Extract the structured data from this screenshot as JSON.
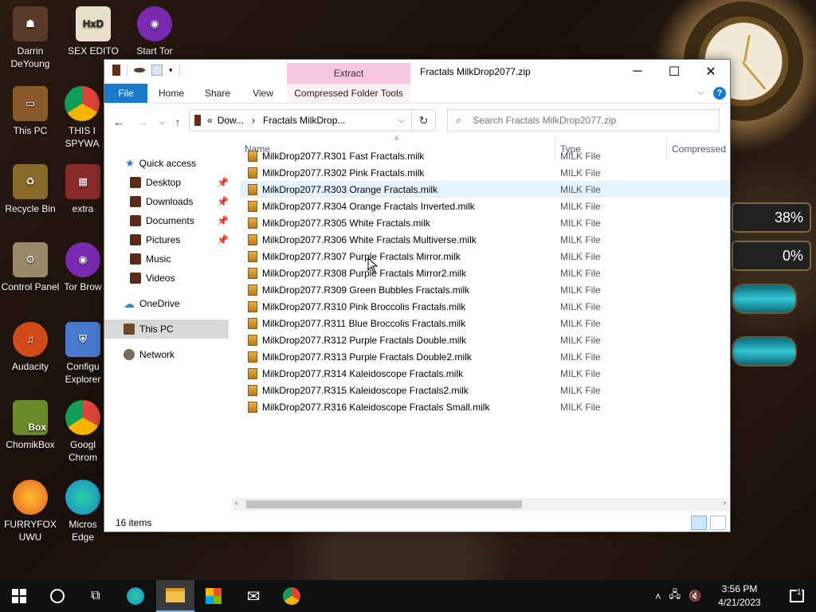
{
  "desktop": {
    "icons": [
      {
        "label": "Darrin DeYoung",
        "color": "#5a3a2a"
      },
      {
        "label": "SEX EDITO",
        "color": "#4a8a3a"
      },
      {
        "label": "Start Tor",
        "color": "#7a2ab0"
      },
      {
        "label": "This PC",
        "color": "#8a5a2a"
      },
      {
        "label": "THIS I SPYWA",
        "color": "#1a73e8"
      },
      {
        "label": "Recycle Bin",
        "color": "#8a6a2a"
      },
      {
        "label": "extra",
        "color": "#8a2a2a"
      },
      {
        "label": "Control Panel",
        "color": "#9a8a6a"
      },
      {
        "label": "Tor Brow",
        "color": "#7a2ab0"
      },
      {
        "label": "Audacity",
        "color": "#d04a1a"
      },
      {
        "label": "Configu Explorer",
        "color": "#4a7ad0"
      },
      {
        "label": "ChomikBox",
        "color": "#6a8a2a"
      },
      {
        "label": "Googl Chrom",
        "color": "#1a73e8"
      },
      {
        "label": "FURRYFOX UWU",
        "color": "#e0602a"
      },
      {
        "label": "Micros Edge",
        "color": "#1a8ad0"
      }
    ],
    "box_label": "Box",
    "gauge1": "38%",
    "gauge2": "0%"
  },
  "window": {
    "title": "Fractals MilkDrop2077.zip",
    "extract_tab": "Extract",
    "ribbon": {
      "file": "File",
      "home": "Home",
      "share": "Share",
      "view": "View",
      "tools": "Compressed Folder Tools"
    },
    "address": {
      "prefix": "«",
      "crumb1": "Dow...",
      "sep": "›",
      "crumb2": "Fractals MilkDrop..."
    },
    "search_placeholder": "Search Fractals MilkDrop2077.zip",
    "nav": {
      "quick_access": "Quick access",
      "desktop": "Desktop",
      "downloads": "Downloads",
      "documents": "Documents",
      "pictures": "Pictures",
      "music": "Music",
      "videos": "Videos",
      "onedrive": "OneDrive",
      "this_pc": "This PC",
      "network": "Network"
    },
    "columns": {
      "name": "Name",
      "type": "Type",
      "compressed": "Compressed s"
    },
    "files": [
      {
        "name": "MilkDrop2077.R301 Fast Fractals.milk",
        "type": "MILK File"
      },
      {
        "name": "MilkDrop2077.R302 Pink Fractals.milk",
        "type": "MILK File"
      },
      {
        "name": "MilkDrop2077.R303 Orange Fractals.milk",
        "type": "MILK File"
      },
      {
        "name": "MilkDrop2077.R304 Orange Fractals Inverted.milk",
        "type": "MILK File"
      },
      {
        "name": "MilkDrop2077.R305 White Fractals.milk",
        "type": "MILK File"
      },
      {
        "name": "MilkDrop2077.R306 White Fractals Multiverse.milk",
        "type": "MILK File"
      },
      {
        "name": "MilkDrop2077.R307 Purple Fractals Mirror.milk",
        "type": "MILK File"
      },
      {
        "name": "MilkDrop2077.R308 Purple Fractals Mirror2.milk",
        "type": "MILK File"
      },
      {
        "name": "MilkDrop2077.R309 Green Bubbles Fractals.milk",
        "type": "MILK File"
      },
      {
        "name": "MilkDrop2077.R310 Pink Broccolis Fractals.milk",
        "type": "MILK File"
      },
      {
        "name": "MilkDrop2077.R311 Blue Broccolis Fractals.milk",
        "type": "MILK File"
      },
      {
        "name": "MilkDrop2077.R312 Purple Fractals Double.milk",
        "type": "MILK File"
      },
      {
        "name": "MilkDrop2077.R313 Purple Fractals Double2.milk",
        "type": "MILK File"
      },
      {
        "name": "MilkDrop2077.R314 Kaleidoscope Fractals.milk",
        "type": "MILK File"
      },
      {
        "name": "MilkDrop2077.R315 Kaleidoscope Fractals2.milk",
        "type": "MILK File"
      },
      {
        "name": "MilkDrop2077.R316 Kaleidoscope Fractals Small.milk",
        "type": "MILK File"
      }
    ],
    "status": "16 items"
  },
  "taskbar": {
    "time": "3:56 PM",
    "date": "4/21/2023",
    "notification_count": "1"
  },
  "colors": {
    "accent": "#1979ca",
    "extract_tab": "#f7c6e0",
    "taskbar": "#101010"
  }
}
